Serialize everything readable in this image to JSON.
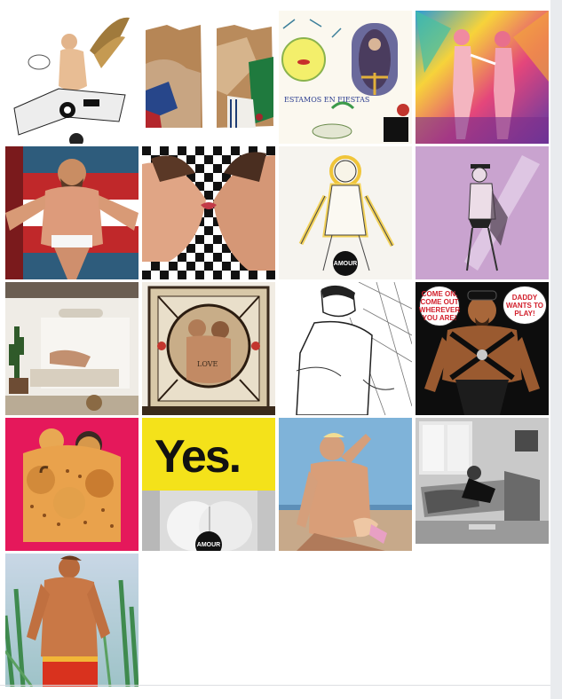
{
  "gallery": {
    "tiles": [
      {
        "name": "winged-figure-artwork"
      },
      {
        "name": "wood-diptych-artwork"
      },
      {
        "name": "estamos-en-fiestas-artwork",
        "caption": "ESTAMOS EN FIESTAS"
      },
      {
        "name": "colorful-dancers-painting"
      },
      {
        "name": "bearded-man-flag-painting"
      },
      {
        "name": "kiss-checkerboard-painting"
      },
      {
        "name": "glowing-sketch-artwork",
        "badge": "AMOUR"
      },
      {
        "name": "lavender-sketch-artwork"
      },
      {
        "name": "courtyard-photo"
      },
      {
        "name": "ornate-frame-artwork",
        "caption": "LOVE"
      },
      {
        "name": "tile-bath-sketch"
      },
      {
        "name": "leather-daddy-comic",
        "bubble_left": "COME ON, COME OUT WHEREVER YOU ARE!",
        "bubble_right": "DADDY WANTS TO PLAY!"
      },
      {
        "name": "bears-hug-artwork"
      },
      {
        "name": "yes-poster",
        "headline": "Yes.",
        "badge": "AMOUR"
      },
      {
        "name": "beach-photo"
      },
      {
        "name": "vintage-interior-photo"
      },
      {
        "name": "cactus-man-painting"
      }
    ]
  },
  "colors": {
    "page_bg": "#e9ebee",
    "panel_bg": "#ffffff",
    "yes_yellow": "#f4e21a",
    "comic_red": "#d21f2b",
    "hot_pink": "#e5185b"
  }
}
